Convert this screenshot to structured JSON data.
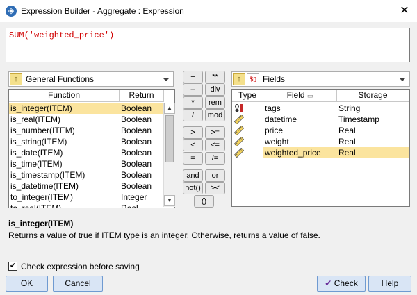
{
  "window": {
    "title": "Expression Builder - Aggregate : Expression",
    "close_glyph": "✕"
  },
  "expression": {
    "text": "SUM('weighted_price')"
  },
  "functions": {
    "category": "General Functions",
    "columns": [
      "Function",
      "Return"
    ],
    "rows": [
      {
        "name": "is_integer(ITEM)",
        "ret": "Boolean"
      },
      {
        "name": "is_real(ITEM)",
        "ret": "Boolean"
      },
      {
        "name": "is_number(ITEM)",
        "ret": "Boolean"
      },
      {
        "name": "is_string(ITEM)",
        "ret": "Boolean"
      },
      {
        "name": "is_date(ITEM)",
        "ret": "Boolean"
      },
      {
        "name": "is_time(ITEM)",
        "ret": "Boolean"
      },
      {
        "name": "is_timestamp(ITEM)",
        "ret": "Boolean"
      },
      {
        "name": "is_datetime(ITEM)",
        "ret": "Boolean"
      },
      {
        "name": "to_integer(ITEM)",
        "ret": "Integer"
      },
      {
        "name": "to_real(ITEM)",
        "ret": "Real"
      }
    ],
    "selected_index": 0
  },
  "operators": [
    "+",
    "**",
    "–",
    "div",
    "*",
    "rem",
    "/",
    "mod",
    ">",
    ">=",
    "<",
    "<=",
    "=",
    "/=",
    "and",
    "or",
    "not()",
    "><",
    "()"
  ],
  "fields": {
    "header": "Fields",
    "columns": [
      "Type",
      "Field",
      "Storage"
    ],
    "rows": [
      {
        "name": "tags",
        "storage": "String",
        "icon": "string-type-icon"
      },
      {
        "name": "datetime",
        "storage": "Timestamp",
        "icon": "ruler-continuous-icon"
      },
      {
        "name": "price",
        "storage": "Real",
        "icon": "ruler-continuous-icon"
      },
      {
        "name": "weight",
        "storage": "Real",
        "icon": "ruler-continuous-icon"
      },
      {
        "name": "weighted_price",
        "storage": "Real",
        "icon": "ruler-continuous-icon"
      }
    ],
    "selected_index": 4
  },
  "description": {
    "title": "is_integer(ITEM)",
    "text": "Returns a value of true if ITEM type is an integer. Otherwise, returns a value of false."
  },
  "check_option": {
    "label": "Check expression before saving",
    "checked": true
  },
  "buttons": {
    "ok": "OK",
    "cancel": "Cancel",
    "check": "Check",
    "help": "Help"
  },
  "colors": {
    "selection": "#fbe49e",
    "expression_text": "#d00000",
    "button_bg": "#d9e5f5"
  }
}
